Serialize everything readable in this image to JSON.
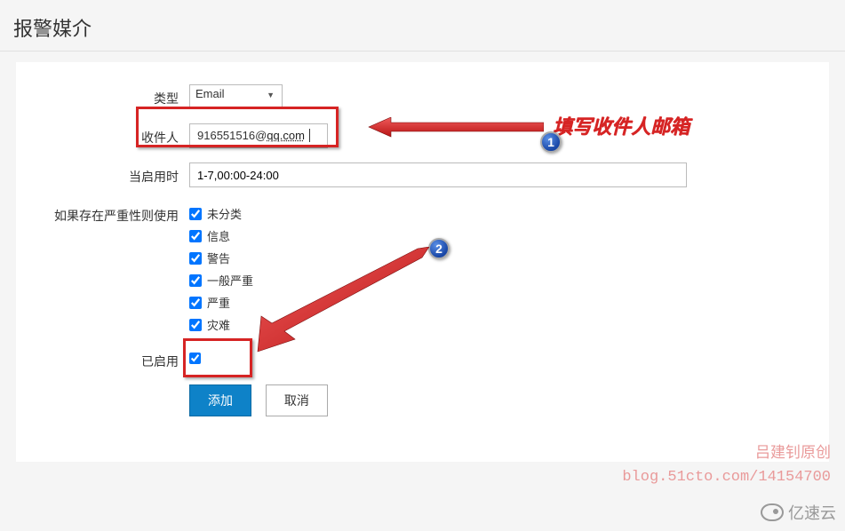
{
  "header": {
    "title": "报警媒介"
  },
  "form": {
    "type_label": "类型",
    "type_value": "Email",
    "recipient_label": "收件人",
    "recipient_prefix": "916551516@",
    "recipient_domain": "qq.com",
    "schedule_label": "当启用时",
    "schedule_value": "1-7,00:00-24:00",
    "severity_label": "如果存在严重性则使用",
    "severity_options": [
      {
        "label": "未分类",
        "checked": true
      },
      {
        "label": "信息",
        "checked": true
      },
      {
        "label": "警告",
        "checked": true
      },
      {
        "label": "一般严重",
        "checked": true
      },
      {
        "label": "严重",
        "checked": true
      },
      {
        "label": "灾难",
        "checked": true
      }
    ],
    "enabled_label": "已启用",
    "enabled_checked": true,
    "add_button": "添加",
    "cancel_button": "取消"
  },
  "annotations": {
    "recipient_hint": "填写收件人邮箱",
    "badge1": "1",
    "badge2": "2"
  },
  "watermark": {
    "line1": "吕建钊原创",
    "line2": "blog.51cto.com/14154700"
  },
  "brand": "亿速云"
}
